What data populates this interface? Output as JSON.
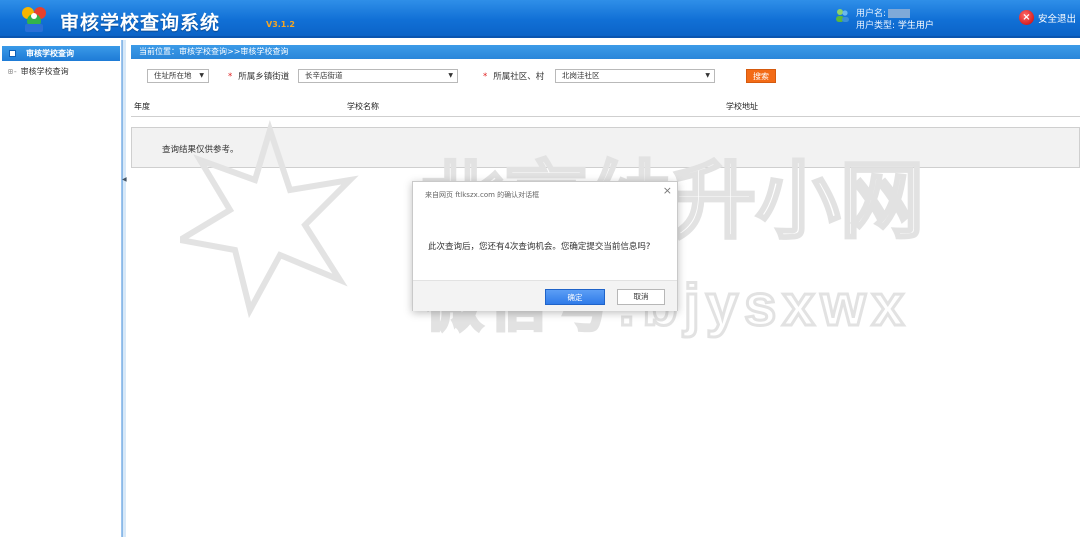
{
  "header": {
    "title": "审核学校查询系统",
    "version": "V3.1.2",
    "user_name_label": "用户名:",
    "user_type_label": "用户类型:",
    "user_type_value": "学生用户",
    "logout_label": "安全退出"
  },
  "sidebar": {
    "section_title": "审核学校查询",
    "items": [
      {
        "label": "审核学校查询"
      }
    ]
  },
  "breadcrumb": "当前位置：审核学校查询>>审核学校查询",
  "filters": {
    "residence_select": "住址所在地",
    "street_label": "所属乡镇街道",
    "street_value": "长辛店街道",
    "community_label": "所属社区、村",
    "community_value": "北岗洼社区",
    "search_label": "搜索"
  },
  "table": {
    "columns": [
      "年度",
      "学校名称",
      "学校地址"
    ]
  },
  "info_text": "查询结果仅供参考。",
  "dialog": {
    "title": "来自网页 ftlkszx.com 的确认对话框",
    "message": "此次查询后，您还有4次查询机会。您确定提交当前信息吗?",
    "ok_label": "确定",
    "cancel_label": "取消"
  },
  "watermark": {
    "line1": "北京幼升小网",
    "line2": "微信号:bjysxwx"
  },
  "colors": {
    "header_blue": "#1170d6",
    "search_orange": "#f36b16",
    "ok_blue": "#2f7be9"
  }
}
